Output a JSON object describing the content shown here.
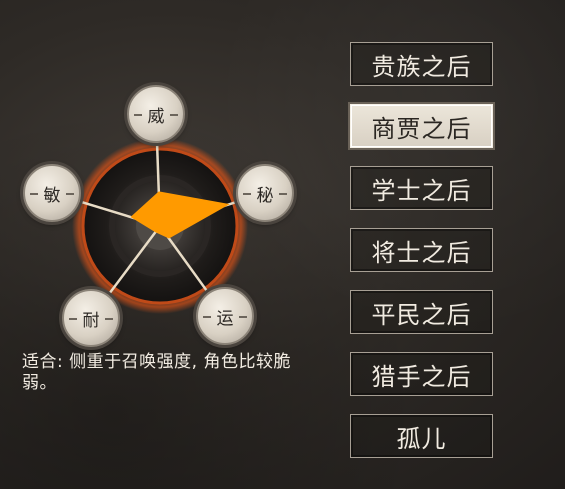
{
  "radar": {
    "stats": [
      {
        "key": "wei",
        "label": "威",
        "value": 0.45
      },
      {
        "key": "mi",
        "label": "秘",
        "value": 0.95
      },
      {
        "key": "yun",
        "label": "运",
        "value": 0.2
      },
      {
        "key": "nai",
        "label": "耐",
        "value": 0.1
      },
      {
        "key": "min",
        "label": "敏",
        "value": 0.4
      }
    ],
    "fill_color": "#ff9a00",
    "ring_color": "#c04a18",
    "spoke_color": "#e8dcc6"
  },
  "description": {
    "text": "适合: 侧重于召唤强度, 角色比较脆弱。"
  },
  "backgrounds": [
    {
      "label": "贵族之后",
      "selected": false
    },
    {
      "label": "商贾之后",
      "selected": true
    },
    {
      "label": "学士之后",
      "selected": false
    },
    {
      "label": "将士之后",
      "selected": false
    },
    {
      "label": "平民之后",
      "selected": false
    },
    {
      "label": "猎手之后",
      "selected": false
    },
    {
      "label": "孤儿",
      "selected": false
    }
  ]
}
